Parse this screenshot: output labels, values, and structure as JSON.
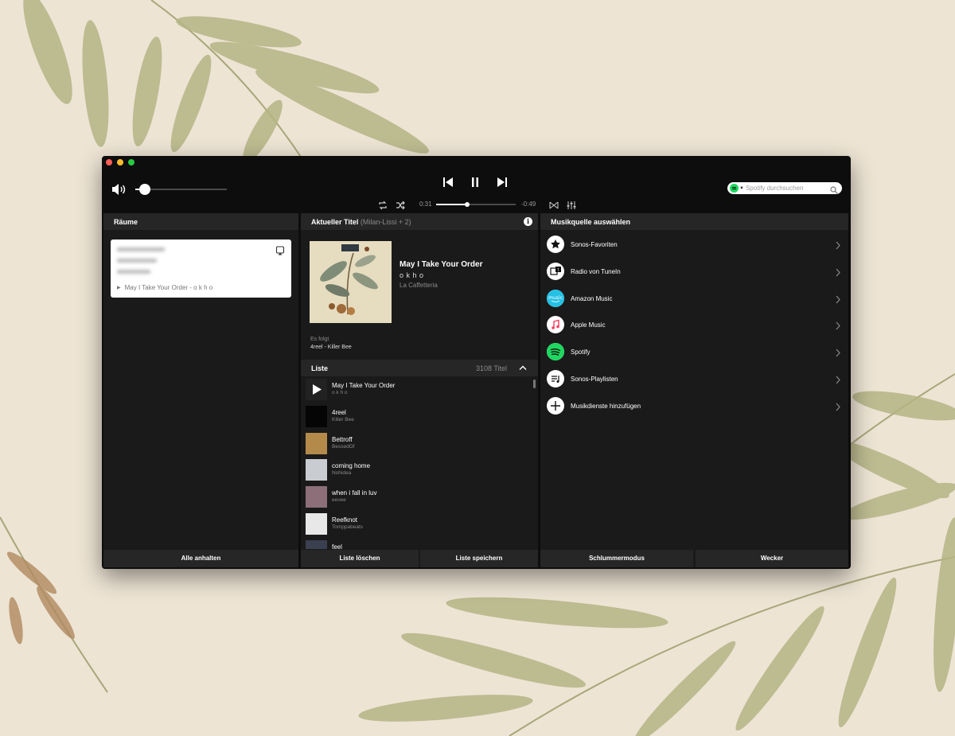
{
  "player": {
    "volume_level": 0.1,
    "progress_fraction": 0.39,
    "elapsed": "0:31",
    "remaining": "-0:49"
  },
  "search": {
    "placeholder": "Spotify durchsuchen"
  },
  "rooms": {
    "header": "Räume",
    "card": {
      "now_playing": "May I Take Your Order - o k h o"
    },
    "footer_button": "Alle anhalten"
  },
  "now_playing": {
    "header": "Aktueller Titel",
    "header_sub": "(Milan-Lissi + 2)",
    "title": "May I Take Your Order",
    "artist": "o k h o",
    "album": "La Caffetteria",
    "next_label": "Es folgt",
    "next_track": "4reel - Killer Bee",
    "list_header": "Liste",
    "list_count": "3108 Titel",
    "queue": [
      {
        "title": "May I Take Your Order",
        "artist": "o k h o",
        "thumb_color": "#222222"
      },
      {
        "title": "4reel",
        "artist": "Killer Bee",
        "thumb_color": "#050505"
      },
      {
        "title": "Bettroff",
        "artist": "BessedOf",
        "thumb_color": "#b48a4a"
      },
      {
        "title": "coming home",
        "artist": "Nohidea",
        "thumb_color": "#c9ccd0"
      },
      {
        "title": "when i fall in luv",
        "artist": "eevee",
        "thumb_color": "#8d6f7a"
      },
      {
        "title": "Reefknot",
        "artist": "Tomppabeats",
        "thumb_color": "#e8e8e8"
      },
      {
        "title": "feel",
        "artist": "",
        "thumb_color": "#3a4050"
      }
    ],
    "footer_clear": "Liste löschen",
    "footer_save": "Liste speichern"
  },
  "sources": {
    "header": "Musikquelle auswählen",
    "items": [
      {
        "label": "Sonos-Favoriten",
        "icon": "star-icon"
      },
      {
        "label": "Radio von TuneIn",
        "icon": "tunein-icon"
      },
      {
        "label": "Amazon Music",
        "icon": "amazon-music-icon"
      },
      {
        "label": "Apple Music",
        "icon": "apple-music-icon"
      },
      {
        "label": "Spotify",
        "icon": "spotify-icon"
      },
      {
        "label": "Sonos-Playlisten",
        "icon": "playlist-icon"
      },
      {
        "label": "Musikdienste hinzufügen",
        "icon": "plus-icon"
      }
    ],
    "footer_sleep": "Schlummermodus",
    "footer_alarm": "Wecker"
  },
  "colors": {
    "background": "#ede4d4",
    "window": "#0d0d0d",
    "panel": "#1a1a1a",
    "panel_header": "#262626",
    "spotify_green": "#1ed760",
    "amazon_blue": "#25c1e5"
  }
}
